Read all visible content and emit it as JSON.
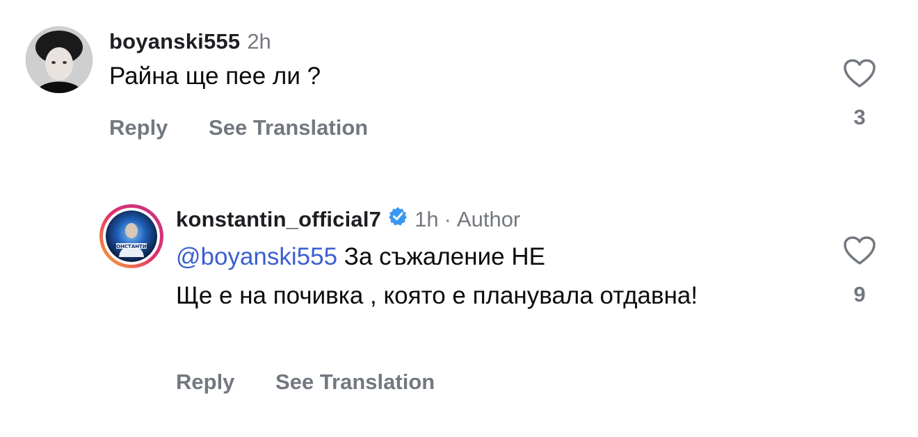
{
  "comments": [
    {
      "username": "boyanski555",
      "time": "2h",
      "text": "Райна ще пее ли ?",
      "reply_label": "Reply",
      "translate_label": "See Translation",
      "like_count": "3"
    },
    {
      "username": "konstantin_official7",
      "time": "1h",
      "separator": "·",
      "author_badge": "Author",
      "mention": "@boyanski555",
      "text_line1": " За съжаление НЕ",
      "text_line2": "Ще е на почивка , която е планувала отдавна!",
      "reply_label": "Reply",
      "translate_label": "See Translation",
      "like_count": "9",
      "avatar_text": "КОНСТАНТИН"
    }
  ],
  "colors": {
    "muted": "#737880",
    "mention": "#3b5fd0",
    "verified": "#3897f0"
  },
  "icons": [
    "heart-icon",
    "verified-badge-icon"
  ]
}
